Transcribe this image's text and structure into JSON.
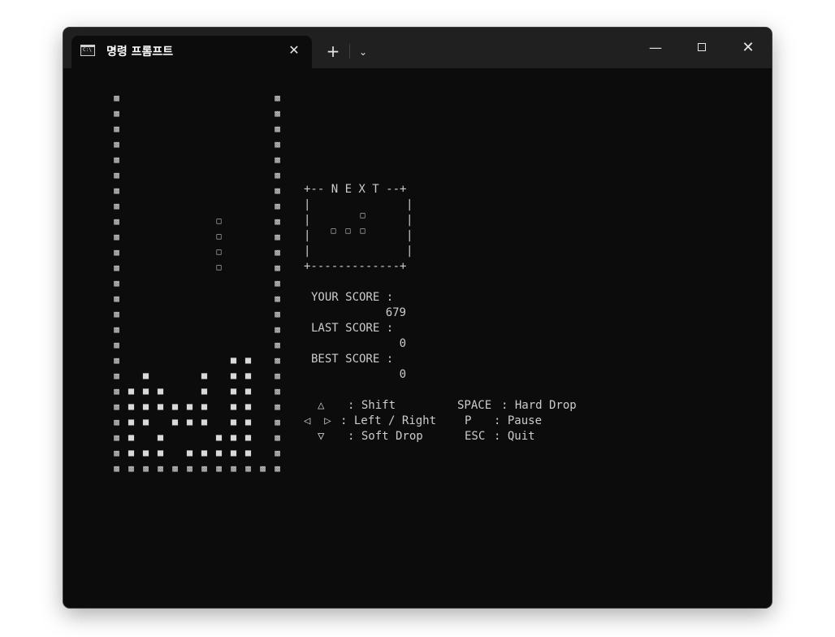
{
  "window": {
    "tab_title": "명령 프롬프트",
    "tab_close": "✕",
    "new_tab": "+",
    "dropdown": "⌄",
    "minimize": "—",
    "close": "✕"
  },
  "glyphs": {
    "wall": "▩",
    "block": "■",
    "piece": "□"
  },
  "next_box": {
    "top": "+-- N E X T --+",
    "side": "|",
    "bottom": "+-------------+"
  },
  "scores": {
    "your_label": "YOUR SCORE :",
    "your_value": "679",
    "last_label": "LAST SCORE :",
    "last_value": "0",
    "best_label": "BEST SCORE :",
    "best_value": "0"
  },
  "controls": {
    "up_key": "△",
    "up_action": ": Shift",
    "lr_keys": "◁  ▷",
    "lr_action": ": Left / Right",
    "down_key": "▽",
    "down_action": ": Soft Drop",
    "space_key": "SPACE",
    "space_action": ": Hard Drop",
    "p_key": "P",
    "p_action": ": Pause",
    "esc_key": "ESC",
    "esc_action": ": Quit"
  },
  "board": {
    "width": 10,
    "rows": [
      "..........",
      "..........",
      "..........",
      "..........",
      "..........",
      "..........",
      "..........",
      "..........",
      "......o...",
      "......o...",
      "......o...",
      "......o...",
      "..........",
      "..........",
      "..........",
      "..........",
      "..........",
      ".......##.",
      ".#...#.##.",
      "###..#.##.",
      "######.##.",
      "##.###.##.",
      "#.#...###.",
      "###.#####."
    ],
    "next_piece": [
      "..o.",
      "ooo."
    ]
  }
}
